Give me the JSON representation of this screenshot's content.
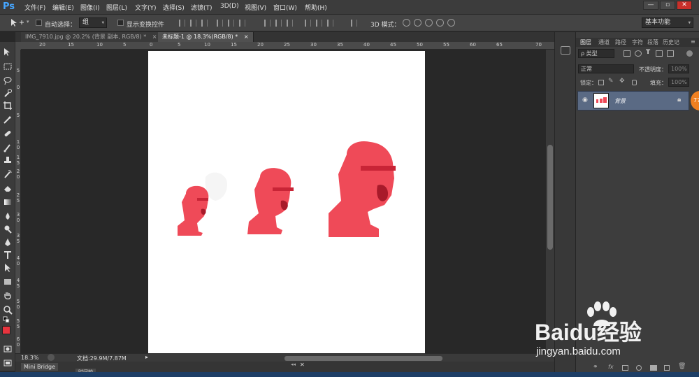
{
  "app": {
    "logo": "Ps"
  },
  "menu": [
    "文件(F)",
    "编辑(E)",
    "图像(I)",
    "图层(L)",
    "文字(Y)",
    "选择(S)",
    "滤镜(T)",
    "3D(D)",
    "视图(V)",
    "窗口(W)",
    "帮助(H)"
  ],
  "window_controls": {
    "minimize": "—",
    "restore": "▫",
    "close": "✕"
  },
  "options": {
    "auto_select_label": "自动选择：",
    "auto_select_value": "组",
    "show_transform_label": "显示变换控件",
    "mode_3d_label": "3D 模式：",
    "workspace_value": "基本功能"
  },
  "tabs": [
    {
      "label": "IMG_7910.jpg @ 20.2% (背景 副本, RGB/8) *",
      "close": "×",
      "active": false
    },
    {
      "label": "未标题-1 @ 18.3%(RGB/8) *",
      "close": "×",
      "active": true
    }
  ],
  "ruler_h": [
    "20",
    "15",
    "10",
    "5",
    "0",
    "5",
    "10",
    "15",
    "20",
    "25",
    "30",
    "35",
    "40",
    "45",
    "50",
    "55",
    "60",
    "65",
    "70"
  ],
  "ruler_v": [
    "5",
    "0",
    "5",
    "1 0",
    "1 5",
    "2 0",
    "2 5",
    "3 0",
    "3 5",
    "4 0",
    "4 5",
    "5 0",
    "5 5",
    "6 0"
  ],
  "status": {
    "zoom": "18.3%",
    "doc_info": "文档:29.9M/7.87M"
  },
  "bottom": {
    "mini_bridge": "Mini Bridge",
    "timeline": "时间轴"
  },
  "panel": {
    "tabs": [
      "图层",
      "通道",
      "路径",
      "字符",
      "段落",
      "历史记"
    ],
    "filter_kind": "ρ 类型",
    "blend_mode": "正常",
    "opacity_label": "不透明度：",
    "opacity_value": "100%",
    "lock_label": "锁定：",
    "fill_label": "填充：",
    "fill_value": "100%",
    "layer_name": "背景",
    "badge": "77"
  },
  "watermark": {
    "brand": "Baidu经验",
    "url": "jingyan.baidu.com"
  },
  "colors": {
    "foreground": "#e8343e",
    "background": "#6a4bd6",
    "accent": "#46a6ff"
  }
}
